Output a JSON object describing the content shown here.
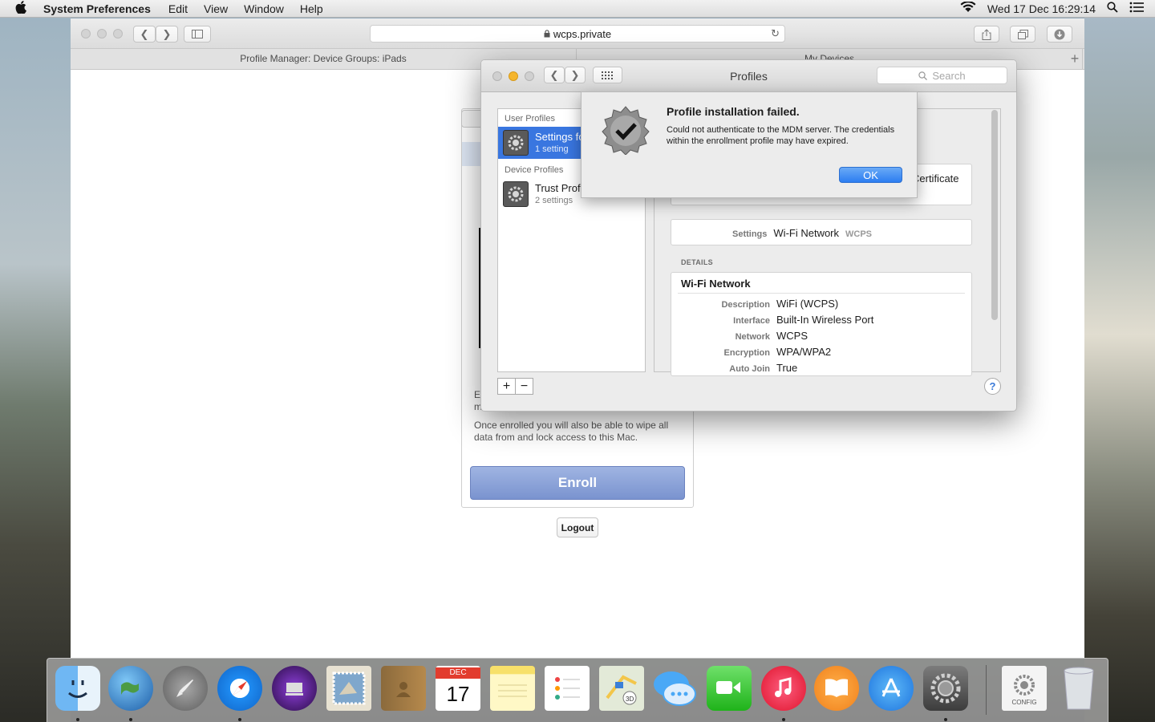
{
  "menubar": {
    "app_name": "System Preferences",
    "items": [
      "Edit",
      "View",
      "Window",
      "Help"
    ],
    "datetime": "Wed 17 Dec  16:29:14"
  },
  "safari": {
    "url": "wcps.private",
    "tabs": [
      "Profile Manager: Device Groups: iPads",
      "My Devices"
    ]
  },
  "webpage": {
    "fragment_1": "E",
    "fragment_2": "m",
    "enroll_text": "Once enrolled you will also be able to wipe all data from and lock access to this Mac.",
    "enroll_button": "Enroll",
    "logout_button": "Logout"
  },
  "profiles_window": {
    "title": "Profiles",
    "search_placeholder": "Search",
    "user_profiles_header": "User Profiles",
    "device_profiles_header": "Device Profiles",
    "user_profile": {
      "name": "Settings fo",
      "sub": "1 setting"
    },
    "device_profile": {
      "name": "Trust Profi",
      "sub": "2 settings"
    },
    "certificate_fragment": "Certificate",
    "settings_label": "Settings",
    "settings_value": "Wi-Fi Network",
    "settings_extra": "WCPS",
    "details_header": "DETAILS",
    "details_section": "Wi-Fi Network",
    "details": [
      {
        "label": "Description",
        "value": "WiFi (WCPS)"
      },
      {
        "label": "Interface",
        "value": "Built-In Wireless Port"
      },
      {
        "label": "Network",
        "value": "WCPS"
      },
      {
        "label": "Encryption",
        "value": "WPA/WPA2"
      },
      {
        "label": "Auto Join",
        "value": "True"
      }
    ],
    "plus": "+",
    "minus": "−",
    "help": "?"
  },
  "alert": {
    "title": "Profile installation failed.",
    "message": "Could not authenticate to the MDM server. The credentials within the enrollment profile may have expired.",
    "ok_button": "OK"
  },
  "dock": {
    "calendar_month": "DEC",
    "calendar_day": "17",
    "config_label": "CONFIG",
    "maps_badge": "3D"
  }
}
